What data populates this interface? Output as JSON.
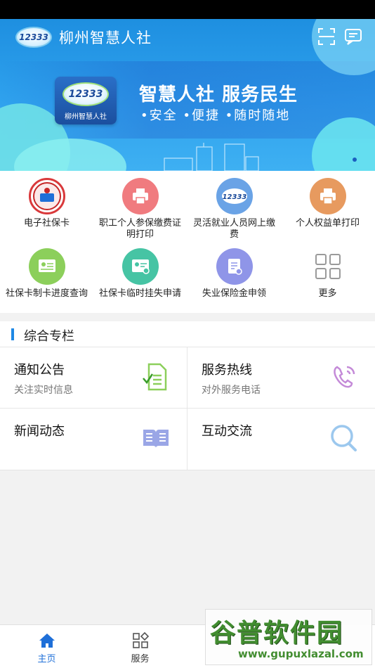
{
  "header": {
    "app_logo_text": "12333",
    "title": "柳州智慧人社"
  },
  "banner": {
    "logo_text": "12333",
    "logo_caption": "柳州智慧人社",
    "slogan": "智慧人社  服务民生",
    "subslogan": "•安全  •便捷  •随时随地"
  },
  "services": [
    {
      "label": "电子社保卡",
      "icon": "social-security-card-icon",
      "color": "#d9393b"
    },
    {
      "label": "职工个人参保缴费证明打印",
      "icon": "printer-icon",
      "color": "#f07b7f"
    },
    {
      "label": "灵活就业人员网上缴费",
      "icon": "12333-badge-icon",
      "color": "#6aa3e6"
    },
    {
      "label": "个人权益单打印",
      "icon": "printer-icon",
      "color": "#e79a5f"
    },
    {
      "label": "社保卡制卡进度查询",
      "icon": "id-card-progress-icon",
      "color": "#8ccf5b"
    },
    {
      "label": "社保卡临时挂失申请",
      "icon": "id-card-loss-icon",
      "color": "#46c4a4"
    },
    {
      "label": "失业保险金申领",
      "icon": "document-edit-icon",
      "color": "#8f95e8"
    },
    {
      "label": "更多",
      "icon": "more-grid-icon",
      "color": "#9a9a9a"
    }
  ],
  "section": {
    "title": "综合专栏"
  },
  "cards": [
    {
      "title": "通知公告",
      "subtitle": "关注实时信息",
      "icon": "notice-doc-icon"
    },
    {
      "title": "服务热线",
      "subtitle": "对外服务电话",
      "icon": "phone-call-icon"
    },
    {
      "title": "新闻动态",
      "subtitle": "",
      "icon": "open-book-icon"
    },
    {
      "title": "互动交流",
      "subtitle": "",
      "icon": "search-magnifier-icon"
    }
  ],
  "tabs": [
    {
      "label": "主页",
      "icon": "home-icon",
      "active": true
    },
    {
      "label": "服务",
      "icon": "services-grid-icon",
      "active": false
    }
  ],
  "colors": {
    "accent": "#1e6fd8",
    "banner": "#2fa2ee"
  },
  "watermark": {
    "brand": "谷普软件园",
    "url": "www.gupuxlazal.com"
  }
}
